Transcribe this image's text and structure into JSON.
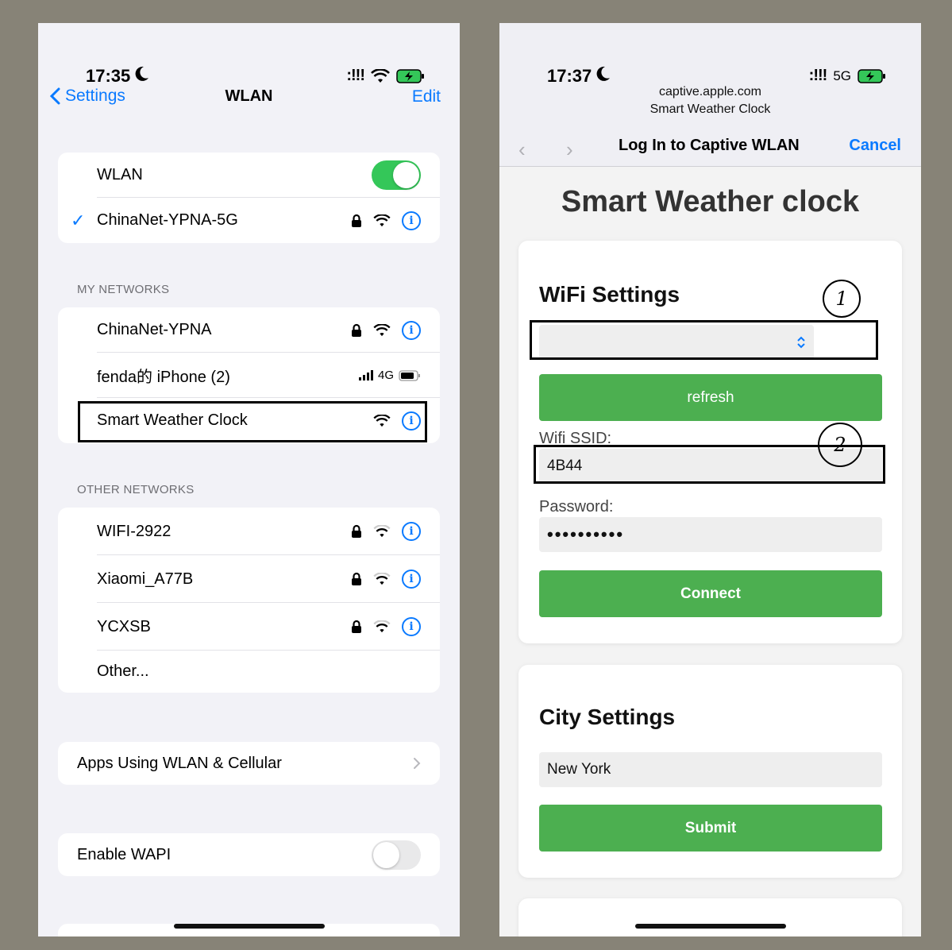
{
  "left": {
    "status": {
      "time": "17:35",
      "dots": ":!!!"
    },
    "nav": {
      "back_label": "Settings",
      "title": "WLAN",
      "edit_label": "Edit"
    },
    "wlan_toggle_label": "WLAN",
    "connected_network": "ChinaNet-YPNA-5G",
    "my_networks_header": "MY NETWORKS",
    "my_networks": [
      "ChinaNet-YPNA",
      "fenda的 iPhone (2)",
      "Smart Weather Clock"
    ],
    "hotspot_signal": "4G",
    "other_networks_header": "OTHER NETWORKS",
    "other_networks": [
      "WIFI-2922",
      "Xiaomi_A77B",
      "YCXSB"
    ],
    "other_label": "Other...",
    "apps_using_label": "Apps Using WLAN & Cellular",
    "wapi_label": "Enable WAPI"
  },
  "right": {
    "status": {
      "time": "17:37",
      "dots": ":!!!",
      "network": "5G"
    },
    "url": "captive.apple.com",
    "page_name": "Smart Weather Clock",
    "toolbar_title": "Log In to Captive WLAN",
    "cancel_label": "Cancel",
    "page_heading": "Smart Weather clock",
    "wifi": {
      "heading": "WiFi Settings",
      "refresh_label": "refresh",
      "ssid_label": "Wifi SSID:",
      "ssid_value": "4B44",
      "password_label": "Password:",
      "password_value": "••••••••••",
      "connect_label": "Connect"
    },
    "city": {
      "heading": "City Settings",
      "city_value": "New York",
      "submit_label": "Submit"
    },
    "annotations": [
      "1",
      "2"
    ]
  },
  "colors": {
    "accent": "#0a7aff",
    "toggle_on": "#34c759",
    "green_button": "#4caf50",
    "backdrop": "#878377"
  }
}
